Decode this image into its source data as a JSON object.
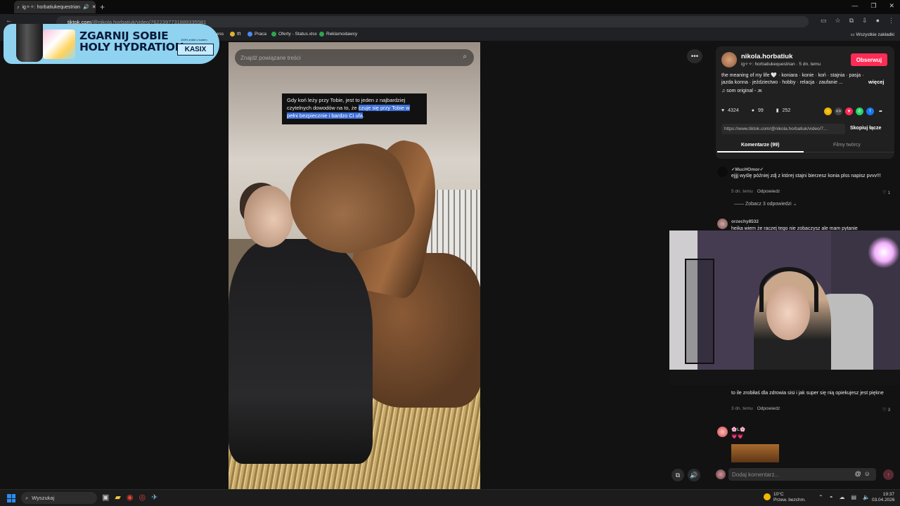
{
  "browser": {
    "tab_title": "ig✧✧: horbatiukequestrian",
    "url_host": "tiktok.com",
    "url_path": "/@nikola.horbatiuk/video/7622397731889335581",
    "bookmarks": [
      {
        "label": "ess"
      },
      {
        "label": "tft"
      },
      {
        "label": "Praca"
      },
      {
        "label": "Oferty - Status.xlsx"
      },
      {
        "label": "Reklamodawcy"
      }
    ],
    "all_bookmarks": "Wszystkie zakładki"
  },
  "ad": {
    "title_line1": "ZGARNIJ SOBIE",
    "title_line2": "HOLY HYDRATION",
    "small_text": "100% zniżki z kodem",
    "badge": "KASIX"
  },
  "video": {
    "search_placeholder": "Znajdź powiązane treści",
    "caption_plain": "Gdy koń leży przy Tobie, jest to jeden z najbardziej czytelnych dowodów na to, że ",
    "caption_highlight": "czuje się przy Tobie w pełni bezpiecznie i bardzo Ci ufa",
    "caption_end": "."
  },
  "author": {
    "username": "nikola.horbatiuk",
    "subtitle": "ig✧✧: horbatiukequestrian · 5 dn. temu",
    "follow_label": "Obserwuj",
    "description": "the meaning of my life 🤍 · koniara · konie · koń · stajnia · pasja · jazda konna · jeździectwo · hobby · relacja · zaufanie ...",
    "more_label": "więcej",
    "sound": "som original - ᴊᴋ"
  },
  "stats": {
    "likes": "4324",
    "comments": "99",
    "saves": "252"
  },
  "share": {
    "link": "https://www.tiktok.com/@nikola.horbatiuk/video/7...",
    "copy_label": "Skopiuj łącze"
  },
  "comment_tabs": {
    "comments": "Komentarze (99)",
    "creator_videos": "Filmy twórcy"
  },
  "comments": [
    {
      "name": "✓MucHOmor✓",
      "text": "ejjjj wyślę później zdj z której stajni bierzesz konia plss napisz pvvv!!!",
      "time": "5 dn. temu",
      "reply": "Odpowiedz",
      "likes": "1"
    },
    {
      "name": "orzechy8532",
      "text": "heika wiem że raczej tego nie zobaczysz ale mam pytanie"
    },
    {
      "text": "to ile zrobiłaś dla zdrowia sisi i jak super się nią opiekujesz jest piękne",
      "time": "3 dn. temu",
      "reply": "Odpowiedz",
      "likes": "3"
    },
    {
      "name": "🌸L🌸",
      "text": "💗💗"
    }
  ],
  "view_replies": "Zobacz 3 odpowiedzi",
  "comment_input": {
    "placeholder": "Dodaj komentarz..."
  },
  "taskbar": {
    "search_label": "Wyszukaj",
    "weather_temp": "10°C",
    "weather_desc": "Przew. bezchm.",
    "time": "19:37",
    "date": "03.04.2026"
  },
  "colors": {
    "accent": "#fe2c55",
    "highlight": "#3c6fd8",
    "background": "#121212"
  }
}
